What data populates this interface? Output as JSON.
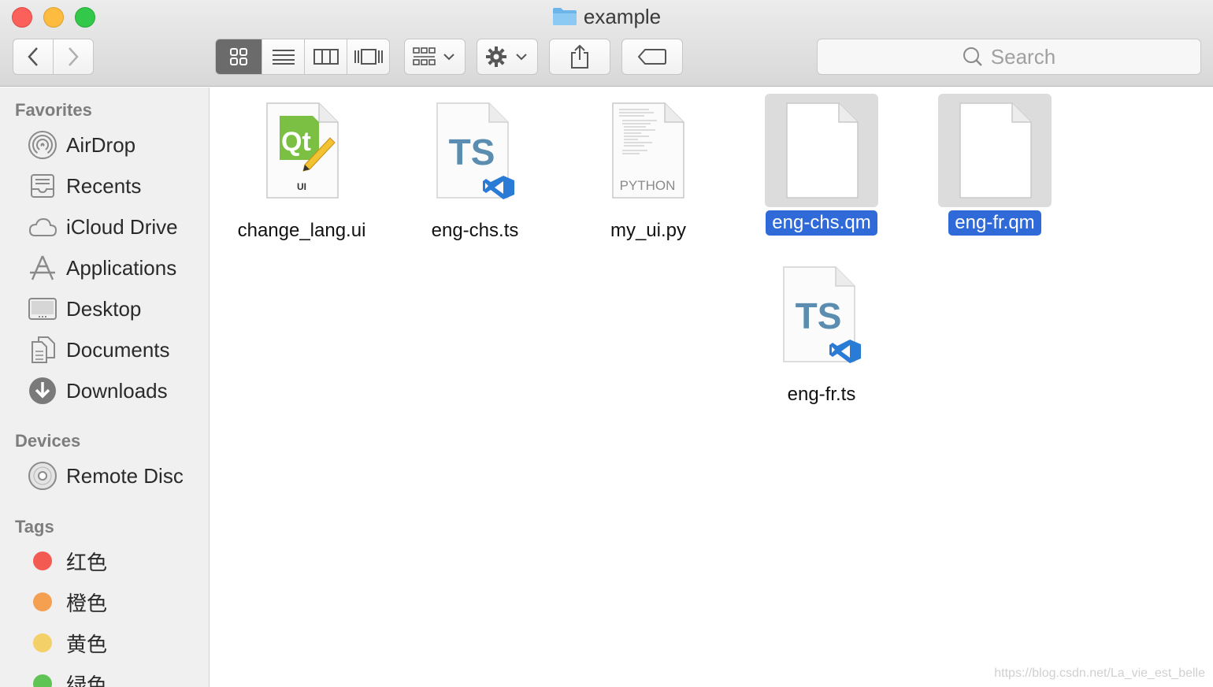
{
  "window": {
    "title": "example"
  },
  "toolbar": {
    "back_icon": "chevron-left-icon",
    "forward_icon": "chevron-right-icon",
    "view_modes": [
      "icon-view",
      "list-view",
      "column-view",
      "gallery-view"
    ],
    "active_view": "icon-view",
    "group_icon": "group-by-icon",
    "action_icon": "gear-icon",
    "share_icon": "share-icon",
    "tag_icon": "tag-icon",
    "search_placeholder": "Search"
  },
  "sidebar": {
    "favorites_header": "Favorites",
    "favorites": [
      {
        "label": "AirDrop",
        "icon": "airdrop-icon"
      },
      {
        "label": "Recents",
        "icon": "recents-icon"
      },
      {
        "label": "iCloud Drive",
        "icon": "cloud-icon"
      },
      {
        "label": "Applications",
        "icon": "applications-icon"
      },
      {
        "label": "Desktop",
        "icon": "desktop-icon"
      },
      {
        "label": "Documents",
        "icon": "documents-icon"
      },
      {
        "label": "Downloads",
        "icon": "downloads-icon"
      }
    ],
    "devices_header": "Devices",
    "devices": [
      {
        "label": "Remote Disc",
        "icon": "disc-icon"
      }
    ],
    "tags_header": "Tags",
    "tags": [
      {
        "label": "红色",
        "color": "#f25a52"
      },
      {
        "label": "橙色",
        "color": "#f5a050"
      },
      {
        "label": "黄色",
        "color": "#f4d068"
      },
      {
        "label": "绿色",
        "color": "#5ec454"
      }
    ]
  },
  "files": [
    {
      "name": "change_lang.ui",
      "icon": "qt-ui-file-icon",
      "selected": false
    },
    {
      "name": "eng-chs.ts",
      "icon": "ts-file-icon",
      "selected": false
    },
    {
      "name": "my_ui.py",
      "icon": "python-file-icon",
      "selected": false,
      "badge": "PYTHON"
    },
    {
      "name": "eng-chs.qm",
      "icon": "blank-file-icon",
      "selected": true
    },
    {
      "name": "eng-fr.qm",
      "icon": "blank-file-icon",
      "selected": true
    },
    {
      "name": "eng-fr.ts",
      "icon": "ts-file-icon",
      "selected": false
    }
  ],
  "qt_badge": {
    "logo": "Qt",
    "label": "UI"
  },
  "ts_badge": "TS",
  "watermark": "https://blog.csdn.net/La_vie_est_belle",
  "colors": {
    "selection": "#2f6ad8",
    "ts_text": "#5b8db0",
    "vscode_blue": "#2a7bd6",
    "qt_green": "#7bc043"
  }
}
